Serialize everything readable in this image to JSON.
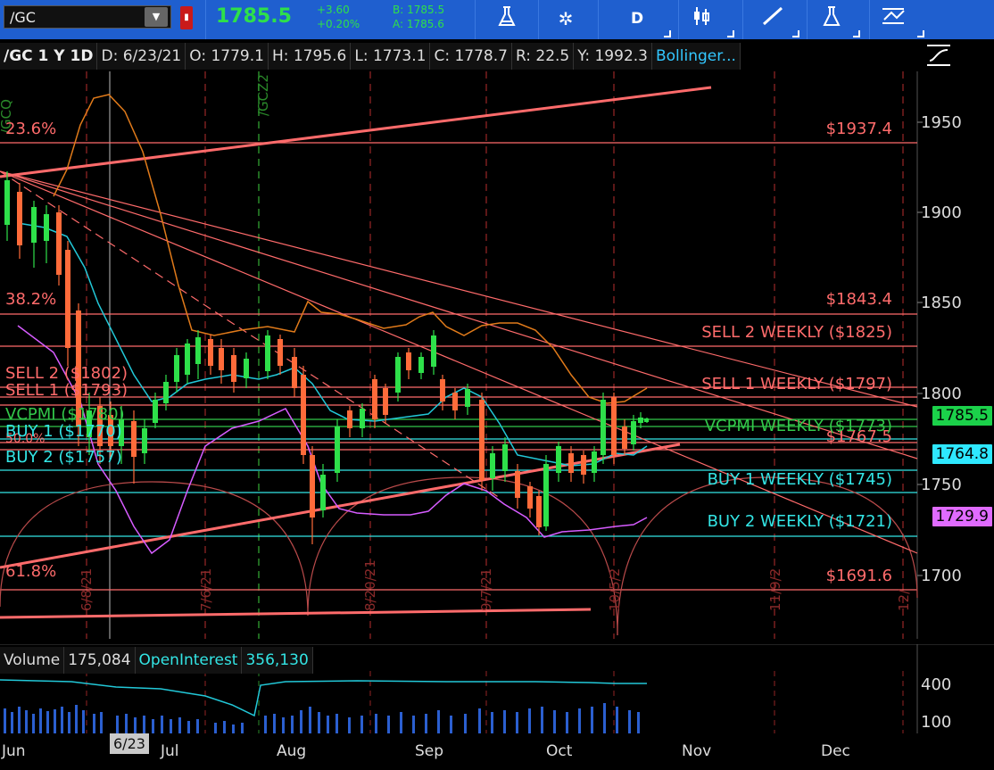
{
  "toolbar": {
    "symbol": "/GC",
    "last": "1785.5",
    "change_abs": "+3.60",
    "change_pct": "+0.20%",
    "bid": "B: 1785.5",
    "ask": "A: 1785.6",
    "period_label": "D",
    "icons": [
      "flask-icon",
      "gear-icon",
      "period-button",
      "candle-style-icon",
      "drawing-icon",
      "study-flask-icon",
      "patterns-icon"
    ]
  },
  "infobar": {
    "symbol": "/GC 1 Y 1D",
    "date": "D: 6/23/21",
    "open": "O: 1779.1",
    "high": "H: 1795.6",
    "low": "L: 1773.1",
    "close": "C: 1778.7",
    "range": "R: 22.5",
    "yearhigh": "Y: 1992.3",
    "study": "Bollinger..."
  },
  "price_axis": {
    "ticks": [
      "1950",
      "1900",
      "1850",
      "1800",
      "1750",
      "1700"
    ],
    "last_tag": "1785.5",
    "mid_tag": "1764.8",
    "lower_tag": "1729.9"
  },
  "levels": {
    "fib_236": "23.6%",
    "fib_382": "38.2%",
    "fib_500": "50.0%",
    "fib_618": "61.8%",
    "p1937": "$1937.4",
    "p1843": "$1843.4",
    "p1767": "$1767.5",
    "p1691": "$1691.6",
    "sell2w": "SELL 2 WEEKLY ($1825)",
    "sell1w": "SELL 1 WEEKLY ($1797)",
    "vcpmiw": "VCPMI WEEKLY ($1773)",
    "buy1w": "BUY 1 WEEKLY ($1745)",
    "buy2w": "BUY 2 WEEKLY ($1721)",
    "sell2": "SELL 2 ($1802)",
    "sell1": "SELL 1 ($1793)",
    "vcpmi": "VCPMI ($1780)",
    "buy1": "BUY 1 ($1770)",
    "buy2": "BUY 2 ($1757)"
  },
  "date_markers": [
    "/GCQ",
    "/GCZ2",
    "6/8/21",
    "7/6/21",
    "8/20/21",
    "9/7/21",
    "10/5/2",
    "11/9/2",
    "12/"
  ],
  "volume_panel": {
    "label": "Volume",
    "volume": "175,084",
    "oi_label": "OpenInterest",
    "oi": "356,130",
    "ticks": [
      "400",
      "100"
    ]
  },
  "xaxis": {
    "months": [
      "Jun",
      "Jul",
      "Aug",
      "Sep",
      "Oct",
      "Nov",
      "Dec"
    ],
    "cursor_tag": "6/23"
  },
  "colors": {
    "toolbar": "#1f5fcf",
    "red_level": "#ff6b6b",
    "cyan_level": "#33e5e5",
    "green_level": "#32c84a",
    "orange_band": "#e07a1a",
    "magenta_band": "#d65cff",
    "cyan_mid": "#22c8d8"
  }
}
